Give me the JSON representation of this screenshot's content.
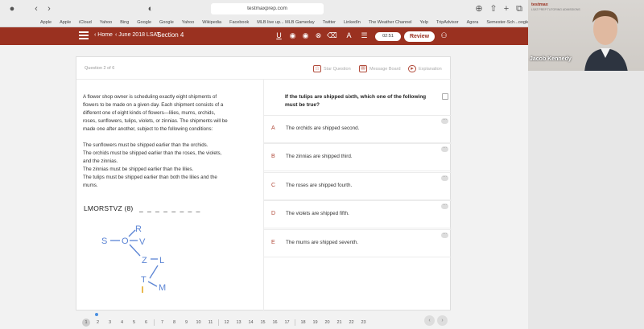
{
  "browser": {
    "url": "testmaxprep.com",
    "bookmarks": [
      "Apple",
      "Apple",
      "iCloud",
      "Yahoo",
      "Bing",
      "Google",
      "Google",
      "Yahoo",
      "Wikipedia",
      "Facebook",
      "MLB live up... MLB Gameday",
      "Twitter",
      "LinkedIn",
      "The Weather Channel",
      "Yelp",
      "TripAdvisor",
      "Agora",
      "Semester-Sch...oogle Drive"
    ]
  },
  "appbar": {
    "home": "Home",
    "exam": "June 2018 LSAT",
    "section": "Section 4",
    "timer": "02:51",
    "review": "Review"
  },
  "card": {
    "question_num": "Question 2 of 6",
    "star_question": "Star Question",
    "message_board": "Message Board",
    "explanation": "Explanation"
  },
  "passage": {
    "intro": "A flower shop owner is scheduling exactly eight shipments of flowers to be made on a given day. Each shipment consists of a different one of eight kinds of flowers—lilies, mums, orchids, roses, sunflowers, tulips, violets, or zinnias. The shipments will be made one after another, subject to the following conditions:",
    "conditions": [
      "The sunflowers must be shipped earlier than the orchids.",
      "The orchids must be shipped earlier than the roses, the violets, and the zinnias.",
      "The zinnias must be shipped earlier than the lilies.",
      "The tulips must be shipped earlier than both the lilies and the mums."
    ],
    "scratch_label": "LMORSTVZ (8)",
    "scratch_blanks": "_ _ _ _ _ _ _ _",
    "sketch_letters": {
      "s": "S",
      "o": "O",
      "v": "V",
      "r": "R",
      "z": "Z",
      "l": "L",
      "t": "T",
      "m": "M"
    }
  },
  "question": {
    "stem": "If the tulips are shipped sixth, which one of the following must be true?",
    "answers": [
      {
        "letter": "A",
        "text": "The orchids are shipped second."
      },
      {
        "letter": "B",
        "text": "The zinnias are shipped third."
      },
      {
        "letter": "C",
        "text": "The roses are shipped fourth."
      },
      {
        "letter": "D",
        "text": "The violets are shipped fifth."
      },
      {
        "letter": "E",
        "text": "The mums are shipped seventh."
      }
    ]
  },
  "pager": {
    "group1": [
      "1",
      "2",
      "3",
      "4",
      "5",
      "6"
    ],
    "group2": [
      "7",
      "8",
      "9",
      "10",
      "11"
    ],
    "group3": [
      "12",
      "13",
      "14",
      "15",
      "16",
      "17"
    ],
    "group4": [
      "18",
      "19",
      "20",
      "21",
      "22",
      "23"
    ]
  },
  "webcam": {
    "logo": "testmax",
    "logo_sub": "LSAT PREP TUTORING ADMISSIONS",
    "name": "Jacob Kennedy"
  },
  "colors": {
    "brand": "#9a3120",
    "accent_blue": "#4a8fe0"
  }
}
